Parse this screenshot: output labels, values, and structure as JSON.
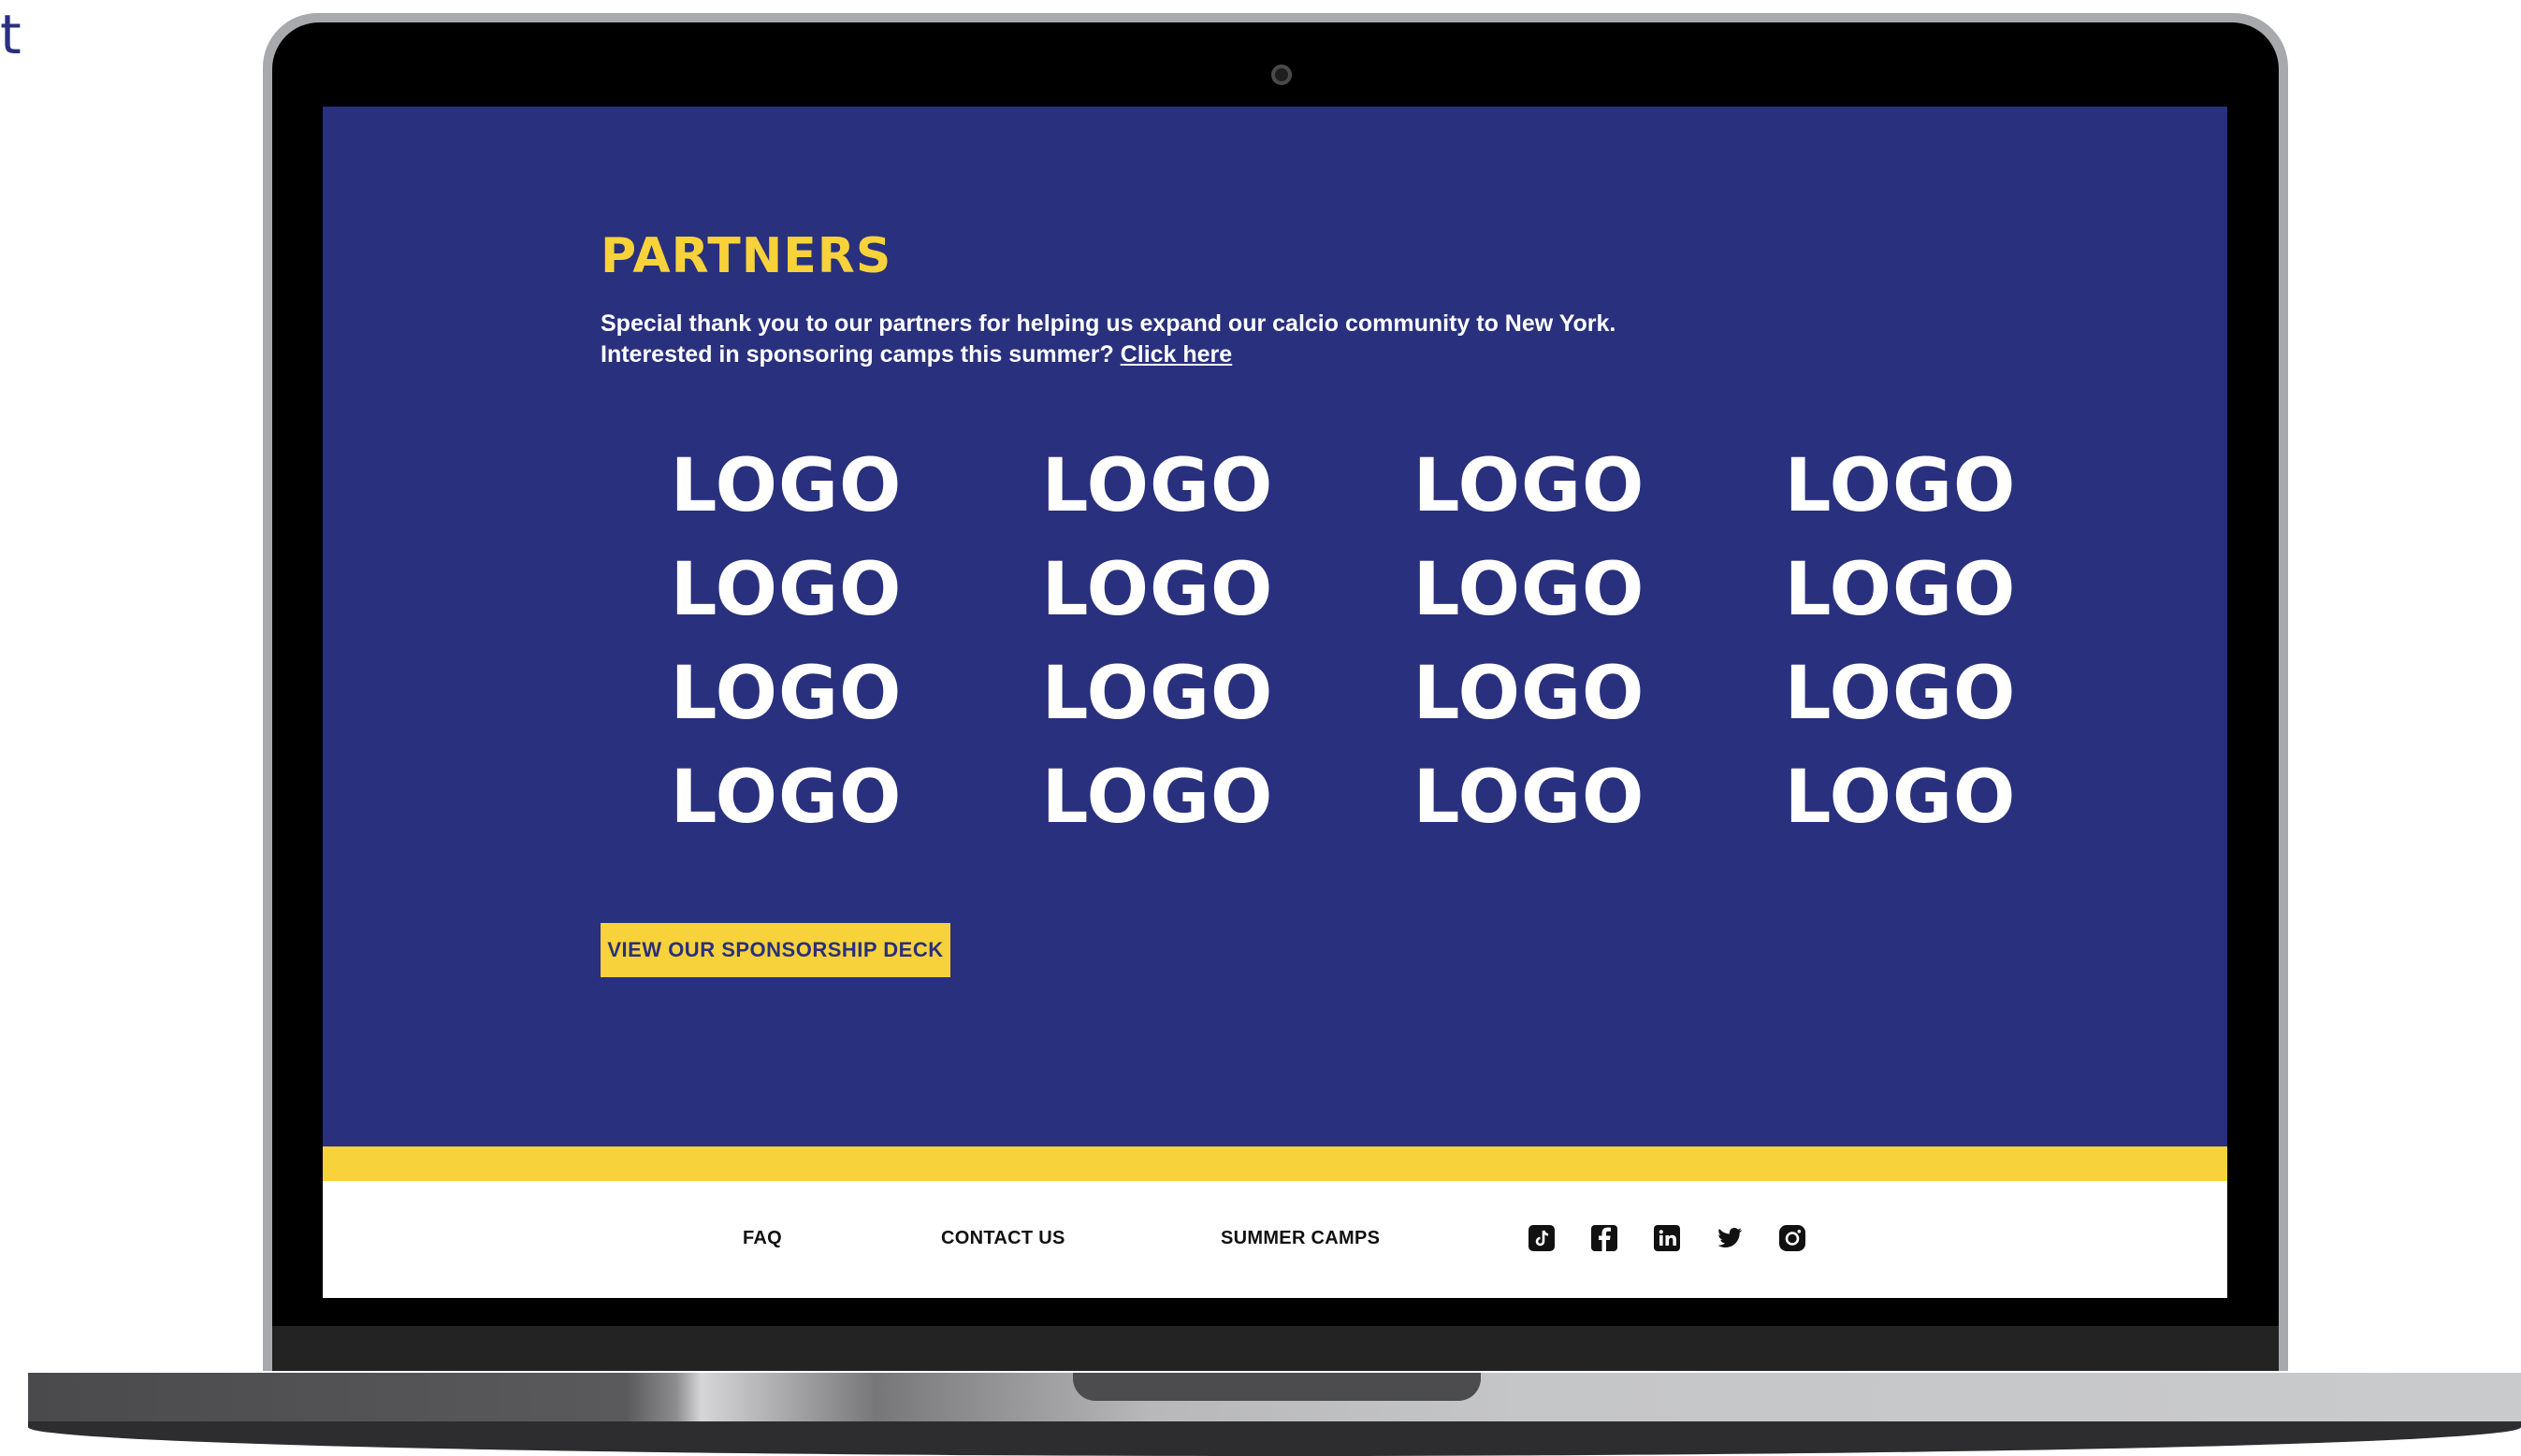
{
  "corner_text": "t",
  "partners": {
    "title": "PARTNERS",
    "intro_line1": "Special thank you to our partners for helping us expand our calcio community to New York.",
    "intro_line2": "Interested in sponsoring camps this summer?",
    "click_here": "Click here",
    "logos": [
      "LOGO",
      "LOGO",
      "LOGO",
      "LOGO",
      "LOGO",
      "LOGO",
      "LOGO",
      "LOGO",
      "LOGO",
      "LOGO",
      "LOGO",
      "LOGO",
      "LOGO",
      "LOGO",
      "LOGO",
      "LOGO"
    ],
    "deck_button": "VIEW OUR SPONSORSHIP DECK"
  },
  "footer": {
    "links": [
      "FAQ",
      "CONTACT US",
      "SUMMER CAMPS"
    ],
    "social_icons": [
      "tiktok-icon",
      "facebook-icon",
      "linkedin-icon",
      "twitter-icon",
      "instagram-icon"
    ]
  },
  "colors": {
    "navy": "#29307d",
    "yellow": "#f8d23a",
    "white": "#ffffff",
    "footer_text": "#111111"
  }
}
